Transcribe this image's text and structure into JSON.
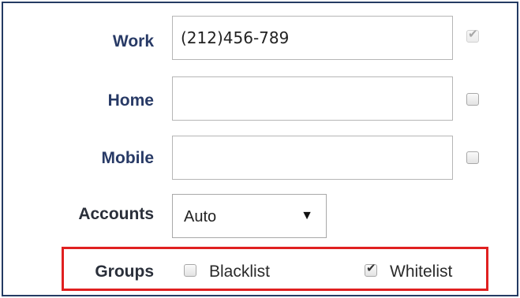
{
  "fields": {
    "work": {
      "label": "Work",
      "value": "(212)456-789",
      "checked": true,
      "checkbox_disabled": true
    },
    "home": {
      "label": "Home",
      "value": "",
      "checked": false
    },
    "mobile": {
      "label": "Mobile",
      "value": "",
      "checked": false
    }
  },
  "accounts": {
    "label": "Accounts",
    "selected": "Auto"
  },
  "groups": {
    "label": "Groups",
    "options": [
      {
        "label": "Blacklist",
        "checked": false
      },
      {
        "label": "Whitelist",
        "checked": true
      }
    ]
  },
  "colors": {
    "border": "#243b63",
    "highlight": "#e02020",
    "label_primary": "#283a66",
    "label_secondary": "#2a2f3a"
  },
  "icons": {
    "checkmark": "check-icon",
    "dropdown": "caret-down-icon"
  }
}
